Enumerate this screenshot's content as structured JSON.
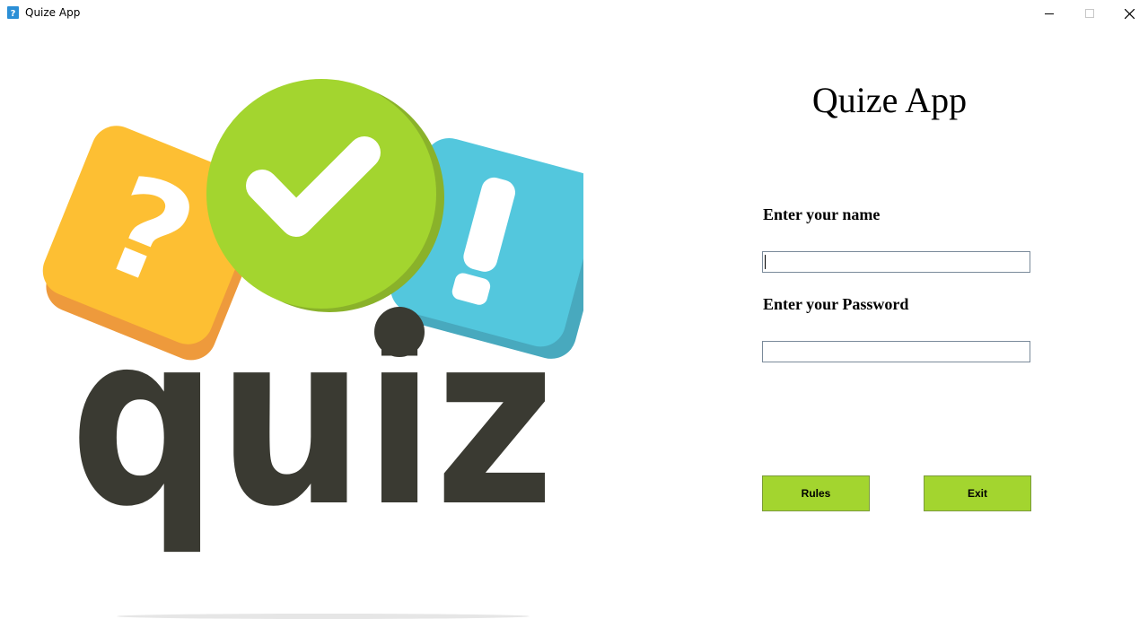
{
  "window": {
    "title": "Quize App"
  },
  "logo": {
    "icon": "quiz-logo",
    "text": "quiz",
    "colors": {
      "yellow": "#fdbf33",
      "green": "#a3d52f",
      "blue": "#53c7dd",
      "dark": "#3a3a32"
    }
  },
  "main": {
    "heading": "Quize App",
    "name_label": "Enter your name",
    "name_value": "",
    "password_label": "Enter your Password",
    "password_value": ""
  },
  "buttons": {
    "rules": "Rules",
    "exit": "Exit",
    "color": "#a3d52f"
  }
}
